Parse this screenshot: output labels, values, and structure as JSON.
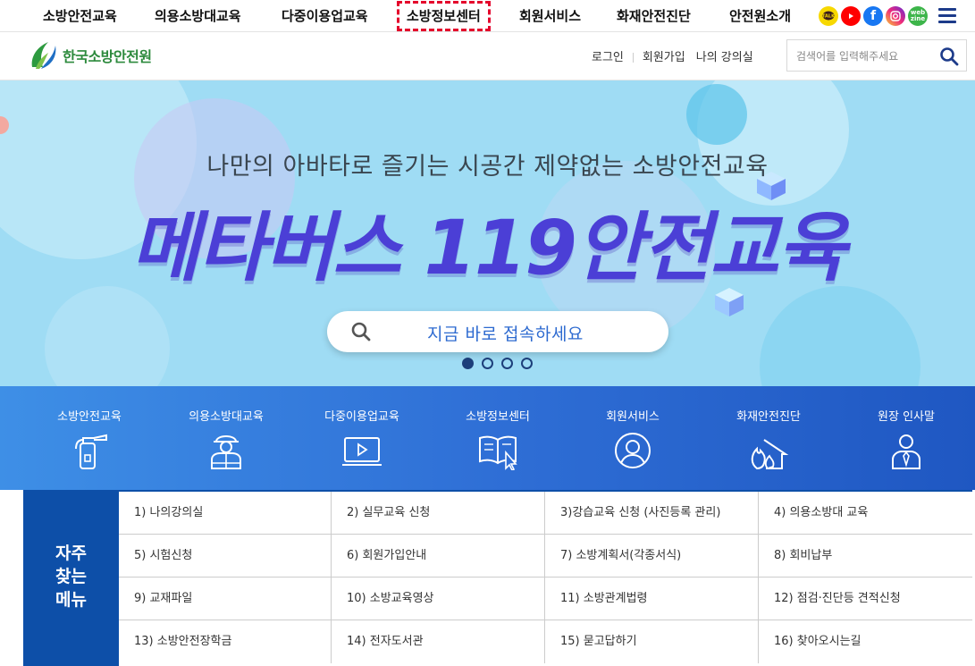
{
  "topnav": {
    "items": [
      "소방안전교육",
      "의용소방대교육",
      "다중이용업교육",
      "소방정보센터",
      "회원서비스",
      "화재안전진단",
      "안전원소개"
    ],
    "active_index": 3,
    "social": {
      "kakao_icon": "kakaotalk-icon",
      "youtube_icon": "youtube-icon",
      "facebook_icon": "facebook-icon",
      "instagram_icon": "instagram-icon",
      "webzine_icon": "webzine-icon"
    },
    "menu_icon": "hamburger-menu-icon"
  },
  "header": {
    "logo_text": "한국소방안전원",
    "links": [
      "로그인",
      "회원가입",
      "나의 강의실"
    ],
    "search": {
      "placeholder": "검색어를 입력해주세요",
      "value": ""
    }
  },
  "banner": {
    "subtitle": "나만의 아바타로 즐기는 시공간 제약없는 소방안전교육",
    "title": "메타버스 119안전교육",
    "cta": "지금 바로 접속하세요",
    "slide_count": 4,
    "active_slide": 1
  },
  "quickmenu": [
    {
      "label": "소방안전교육",
      "icon": "fire-extinguisher-icon"
    },
    {
      "label": "의용소방대교육",
      "icon": "firefighter-icon"
    },
    {
      "label": "다중이용업교육",
      "icon": "video-monitor-icon"
    },
    {
      "label": "소방정보센터",
      "icon": "open-book-cursor-icon"
    },
    {
      "label": "회원서비스",
      "icon": "user-circle-icon"
    },
    {
      "label": "화재안전진단",
      "icon": "house-fire-icon"
    },
    {
      "label": "원장 인사말",
      "icon": "director-person-icon"
    }
  ],
  "favorites": {
    "title_lines": [
      "자주",
      "찾는",
      "메뉴"
    ],
    "items": [
      "1) 나의강의실",
      "2) 실무교육 신청",
      "3)강습교육 신청 (사진등록 관리)",
      "4) 의용소방대 교육",
      "5) 시험신청",
      "6) 회원가입안내",
      "7) 소방계획서(각종서식)",
      "8) 회비납부",
      "9) 교재파일",
      "10) 소방교육영상",
      "11) 소방관계법령",
      "12) 점검·진단등 견적신청",
      "13) 소방안전장학금",
      "14) 전자도서관",
      "15) 묻고답하기",
      "16) 찾아오시는길"
    ]
  },
  "colors": {
    "brand_blue": "#0d4fa8",
    "brand_green": "#2d8a3d",
    "banner_bg": "#9fdcf4",
    "title_purple": "#4b3fd6",
    "active_outline": "#e4002b"
  }
}
